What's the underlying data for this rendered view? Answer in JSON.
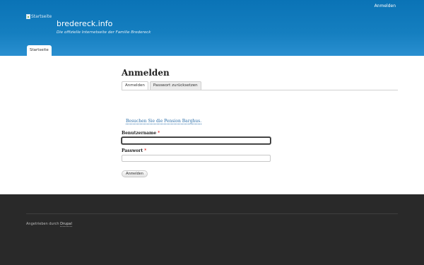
{
  "header": {
    "user_menu": "Anmelden",
    "logo_alt": "Startseite",
    "site_name": "bredereck.info",
    "site_slogan": "Die offizielle Internetseite der Familie Bredereck",
    "primary_tab": "Startseite"
  },
  "main": {
    "page_title": "Anmelden",
    "tabs": [
      {
        "label": "Anmelden",
        "active": true
      },
      {
        "label": "Passwort zurücksetzen",
        "active": false
      }
    ],
    "promo_link": "Besuchen Sie die Pension Barghus.",
    "form": {
      "username_label": "Benutzername",
      "username_value": "",
      "password_label": "Passwort",
      "password_value": "",
      "required_marker": "*",
      "submit_label": "Anmelden"
    }
  },
  "footer": {
    "powered_prefix": "Angetrieben durch",
    "powered_link": "Drupal"
  },
  "colors": {
    "header_blue": "#0a73b6",
    "link_blue": "#2b6ea9",
    "footer_dark": "#292929",
    "required_red": "#dd0000"
  }
}
